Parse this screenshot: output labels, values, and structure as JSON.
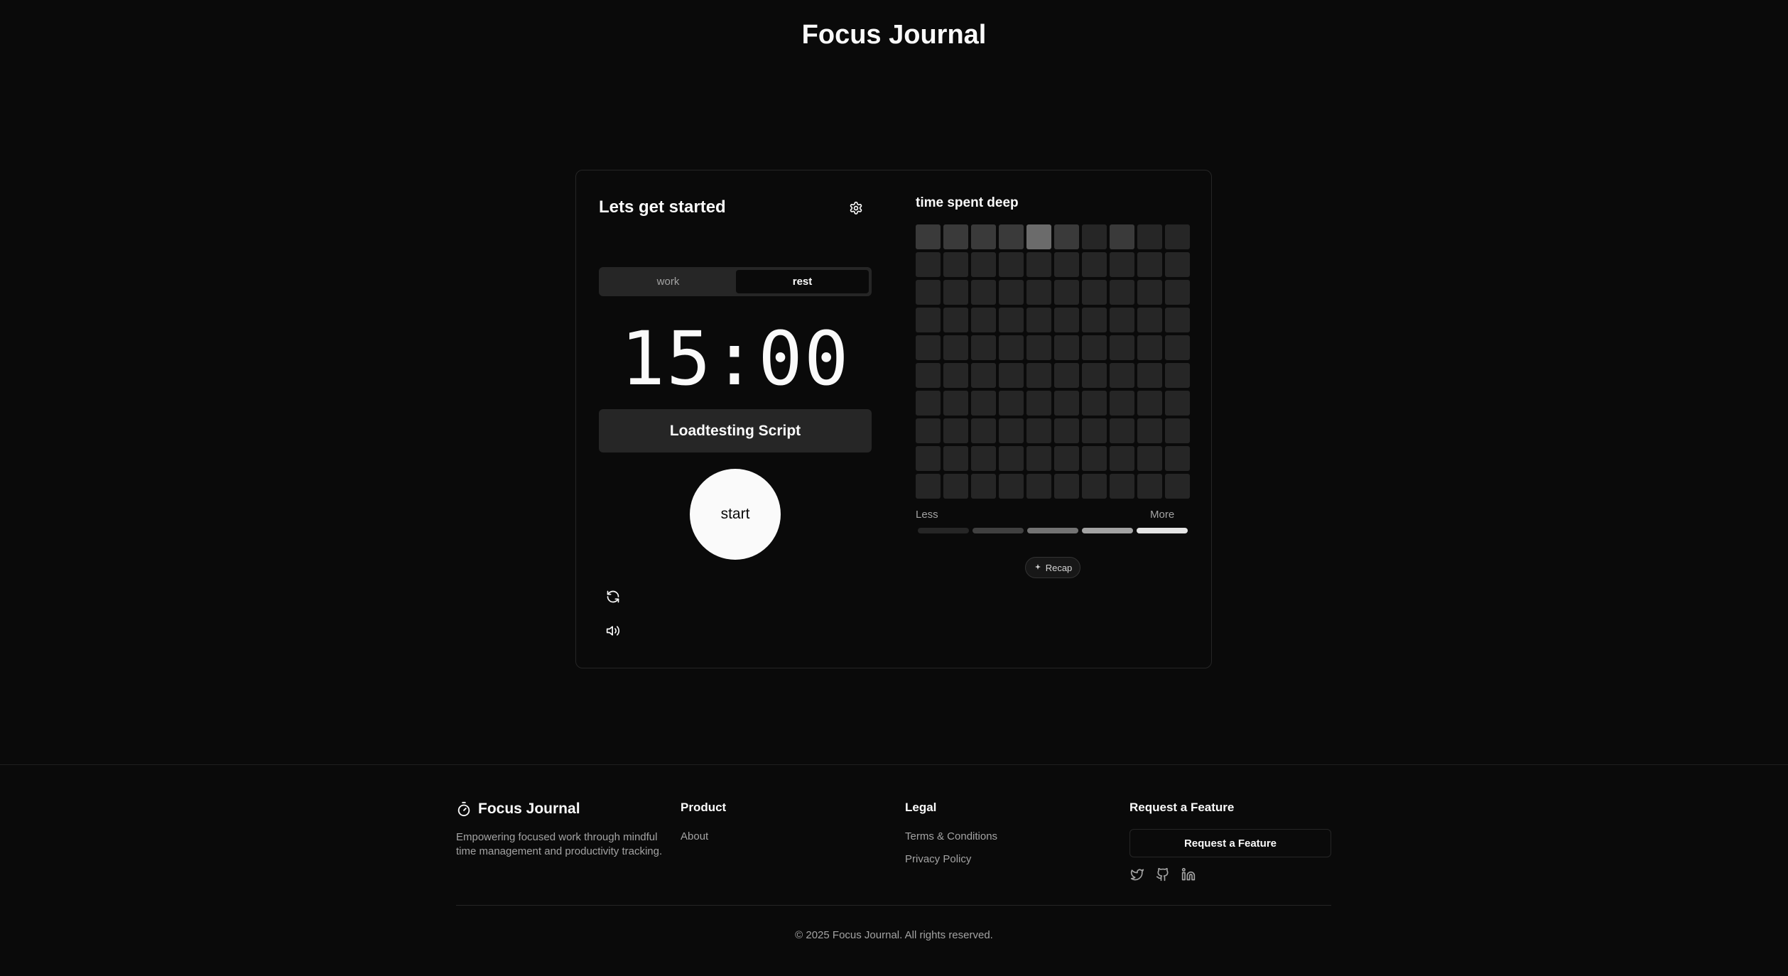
{
  "header": {
    "title": "Focus Journal"
  },
  "timer_card": {
    "title": "Lets get started",
    "settings_icon": "gear-icon",
    "modes": [
      {
        "label": "work",
        "active": false
      },
      {
        "label": "rest",
        "active": true
      }
    ],
    "time": "15:00",
    "task_label": "Loadtesting Script",
    "start_label": "start",
    "reset_icon": "refresh-icon",
    "sound_icon": "volume-icon"
  },
  "heatmap": {
    "title": "time spent deep",
    "legend_less": "Less",
    "legend_more": "More",
    "legend_colors": [
      "#262626",
      "#404040",
      "#737373",
      "#a3a3a3",
      "#e5e5e5"
    ],
    "cell_levels": [
      1,
      1,
      1,
      1,
      2,
      1,
      0,
      1,
      0,
      0
    ],
    "recap_label": "Recap",
    "recap_icon": "sparkles-icon"
  },
  "footer": {
    "brand": "Focus Journal",
    "brand_icon": "stopwatch-icon",
    "tagline": "Empowering focused work through mindful time management and productivity tracking.",
    "product": {
      "title": "Product",
      "links": [
        "About"
      ]
    },
    "legal": {
      "title": "Legal",
      "links": [
        "Terms & Conditions",
        "Privacy Policy"
      ]
    },
    "request": {
      "title": "Request a Feature",
      "button": "Request a Feature"
    },
    "social_icons": [
      "twitter-icon",
      "github-icon",
      "linkedin-icon"
    ],
    "copyright": "© 2025 Focus Journal. All rights reserved."
  }
}
